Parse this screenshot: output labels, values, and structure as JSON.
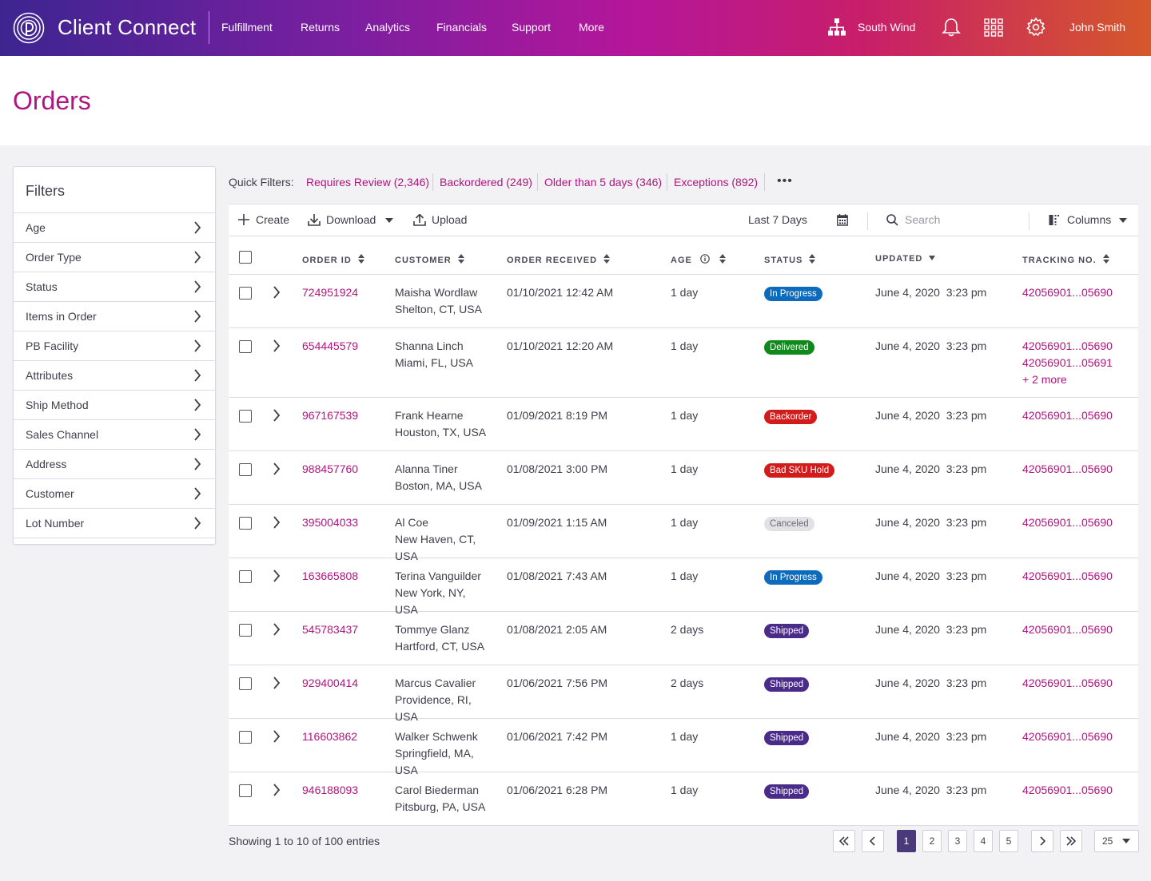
{
  "app": {
    "brand": "Client Connect"
  },
  "nav": {
    "items": [
      "Fulfillment",
      "Returns",
      "Analytics",
      "Financials",
      "Support",
      "More"
    ]
  },
  "topbar": {
    "org": "South Wind",
    "user": "John Smith"
  },
  "page": {
    "title": "Orders"
  },
  "filters": {
    "title": "Filters",
    "items": [
      "Age",
      "Order Type",
      "Status",
      "Items in Order",
      "PB Facility",
      "Attributes",
      "Ship Method",
      "Sales Channel",
      "Address",
      "Customer",
      "Lot Number"
    ]
  },
  "quick_filters": {
    "label": "Quick Filters:",
    "items": [
      "Requires Review (2,346)",
      "Backordered (249)",
      "Older than 5 days (346)",
      "Exceptions (892)"
    ],
    "more": "•••"
  },
  "toolbar": {
    "create": "Create",
    "download": "Download",
    "upload": "Upload",
    "date_range": "Last 7 Days",
    "search_placeholder": "Search",
    "columns": "Columns"
  },
  "table": {
    "headers": {
      "order_id": "ORDER ID",
      "customer": "CUSTOMER",
      "order_received": "ORDER RECEIVED",
      "age": "AGE",
      "status": "STATUS",
      "updated": "UPDATED",
      "tracking": "TRACKING NO."
    },
    "rows": [
      {
        "id": "724951924",
        "name": "Maisha Wordlaw",
        "loc1": "Shelton, CT, USA",
        "loc2": "",
        "received": "01/10/2021 12:42 AM",
        "age": "1 day",
        "status": "In Progress",
        "status_color": "#0d6bbd",
        "updated": "June 4, 2020  3:23 pm",
        "tracking": [
          "42056901...05690"
        ],
        "tracking_more": ""
      },
      {
        "id": "654445579",
        "name": "Shanna Linch",
        "loc1": "Miami, FL, USA",
        "loc2": "",
        "received": "01/10/2021 12:20 AM",
        "age": "1 day",
        "status": "Delivered",
        "status_color": "#0d8a1a",
        "updated": "June 4, 2020  3:23 pm",
        "tracking": [
          "42056901...05690",
          "42056901...05691"
        ],
        "tracking_more": "+ 2 more"
      },
      {
        "id": "967167539",
        "name": "Frank Hearne",
        "loc1": "Houston, TX, USA",
        "loc2": "",
        "received": "01/09/2021 8:19 PM",
        "age": "1 day",
        "status": "Backorder",
        "status_color": "#d41b1b",
        "updated": "June 4, 2020  3:23 pm",
        "tracking": [
          "42056901...05690"
        ],
        "tracking_more": ""
      },
      {
        "id": "988457760",
        "name": "Alanna Tiner",
        "loc1": "Boston, MA, USA",
        "loc2": "",
        "received": "01/08/2021 3:00 PM",
        "age": "1 day",
        "status": "Bad SKU Hold",
        "status_color": "#d41b1b",
        "updated": "June 4, 2020  3:23 pm",
        "tracking": [
          "42056901...05690"
        ],
        "tracking_more": ""
      },
      {
        "id": "395004033",
        "name": "Al Coe",
        "loc1": "New Haven, CT,",
        "loc2": "USA",
        "received": "01/09/2021 1:15 AM",
        "age": "1 day",
        "status": "Canceled",
        "status_color": "#e2e1e6",
        "updated": "June 4, 2020  3:23 pm",
        "tracking": [
          "42056901...05690"
        ],
        "tracking_more": ""
      },
      {
        "id": "163665808",
        "name": "Terina Vanguilder",
        "loc1": "New York, NY,",
        "loc2": "USA",
        "received": "01/08/2021 7:43 AM",
        "age": "1 day",
        "status": "In Progress",
        "status_color": "#0d6bbd",
        "updated": "June 4, 2020  3:23 pm",
        "tracking": [
          "42056901...05690"
        ],
        "tracking_more": ""
      },
      {
        "id": "545783437",
        "name": "Tommye Glanz",
        "loc1": "Hartford, CT, USA",
        "loc2": "",
        "received": "01/08/2021 2:05 AM",
        "age": "2 days",
        "status": "Shipped",
        "status_color": "#4b2b8a",
        "updated": "June 4, 2020  3:23 pm",
        "tracking": [
          "42056901...05690"
        ],
        "tracking_more": ""
      },
      {
        "id": "929400414",
        "name": "Marcus Cavalier",
        "loc1": "Providence, RI,",
        "loc2": "USA",
        "received": "01/06/2021 7:56 PM",
        "age": "2 days",
        "status": "Shipped",
        "status_color": "#4b2b8a",
        "updated": "June 4, 2020  3:23 pm",
        "tracking": [
          "42056901...05690"
        ],
        "tracking_more": ""
      },
      {
        "id": "116603862",
        "name": "Walker Schwenk",
        "loc1": "Springfield, MA,",
        "loc2": "USA",
        "received": "01/06/2021 7:42 PM",
        "age": "1 day",
        "status": "Shipped",
        "status_color": "#4b2b8a",
        "updated": "June 4, 2020  3:23 pm",
        "tracking": [
          "42056901...05690"
        ],
        "tracking_more": ""
      },
      {
        "id": "946188093",
        "name": "Carol Biederman",
        "loc1": "Pitsburg, PA, USA",
        "loc2": "",
        "received": "01/06/2021 6:28 PM",
        "age": "1 day",
        "status": "Shipped",
        "status_color": "#4b2b8a",
        "updated": "June 4, 2020  3:23 pm",
        "tracking": [
          "42056901...05690"
        ],
        "tracking_more": ""
      }
    ]
  },
  "footer": {
    "showing": "Showing 1 to 10 of 100 entries",
    "pages": [
      "1",
      "2",
      "3",
      "4",
      "5"
    ],
    "current_page": "1",
    "per_page": "25"
  },
  "colors": {
    "accent": "#b0157f",
    "page_active": "#4b3a7a"
  }
}
